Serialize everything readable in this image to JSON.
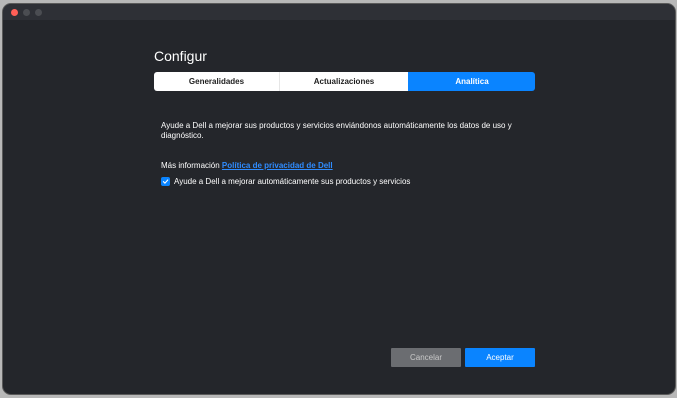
{
  "window": {
    "title": "Configur"
  },
  "tabs": [
    {
      "label": "Generalidades",
      "selected": false
    },
    {
      "label": "Actualizaciones",
      "selected": false
    },
    {
      "label": "Analítica",
      "selected": true
    }
  ],
  "analytics": {
    "description": "Ayude a Dell a mejorar sus productos y servicios enviándonos automáticamente los datos de uso y diagnóstico.",
    "more_info_label": "Más información",
    "privacy_link": "Política de privacidad de Dell",
    "checkbox_label": "Ayude a Dell a mejorar automáticamente sus productos y servicios",
    "checkbox_checked": true
  },
  "footer": {
    "cancel_label": "Cancelar",
    "accept_label": "Aceptar"
  },
  "colors": {
    "accent": "#0a84ff",
    "background": "#24262b",
    "link": "#2f8cff",
    "close_light": "#ff5f57"
  }
}
